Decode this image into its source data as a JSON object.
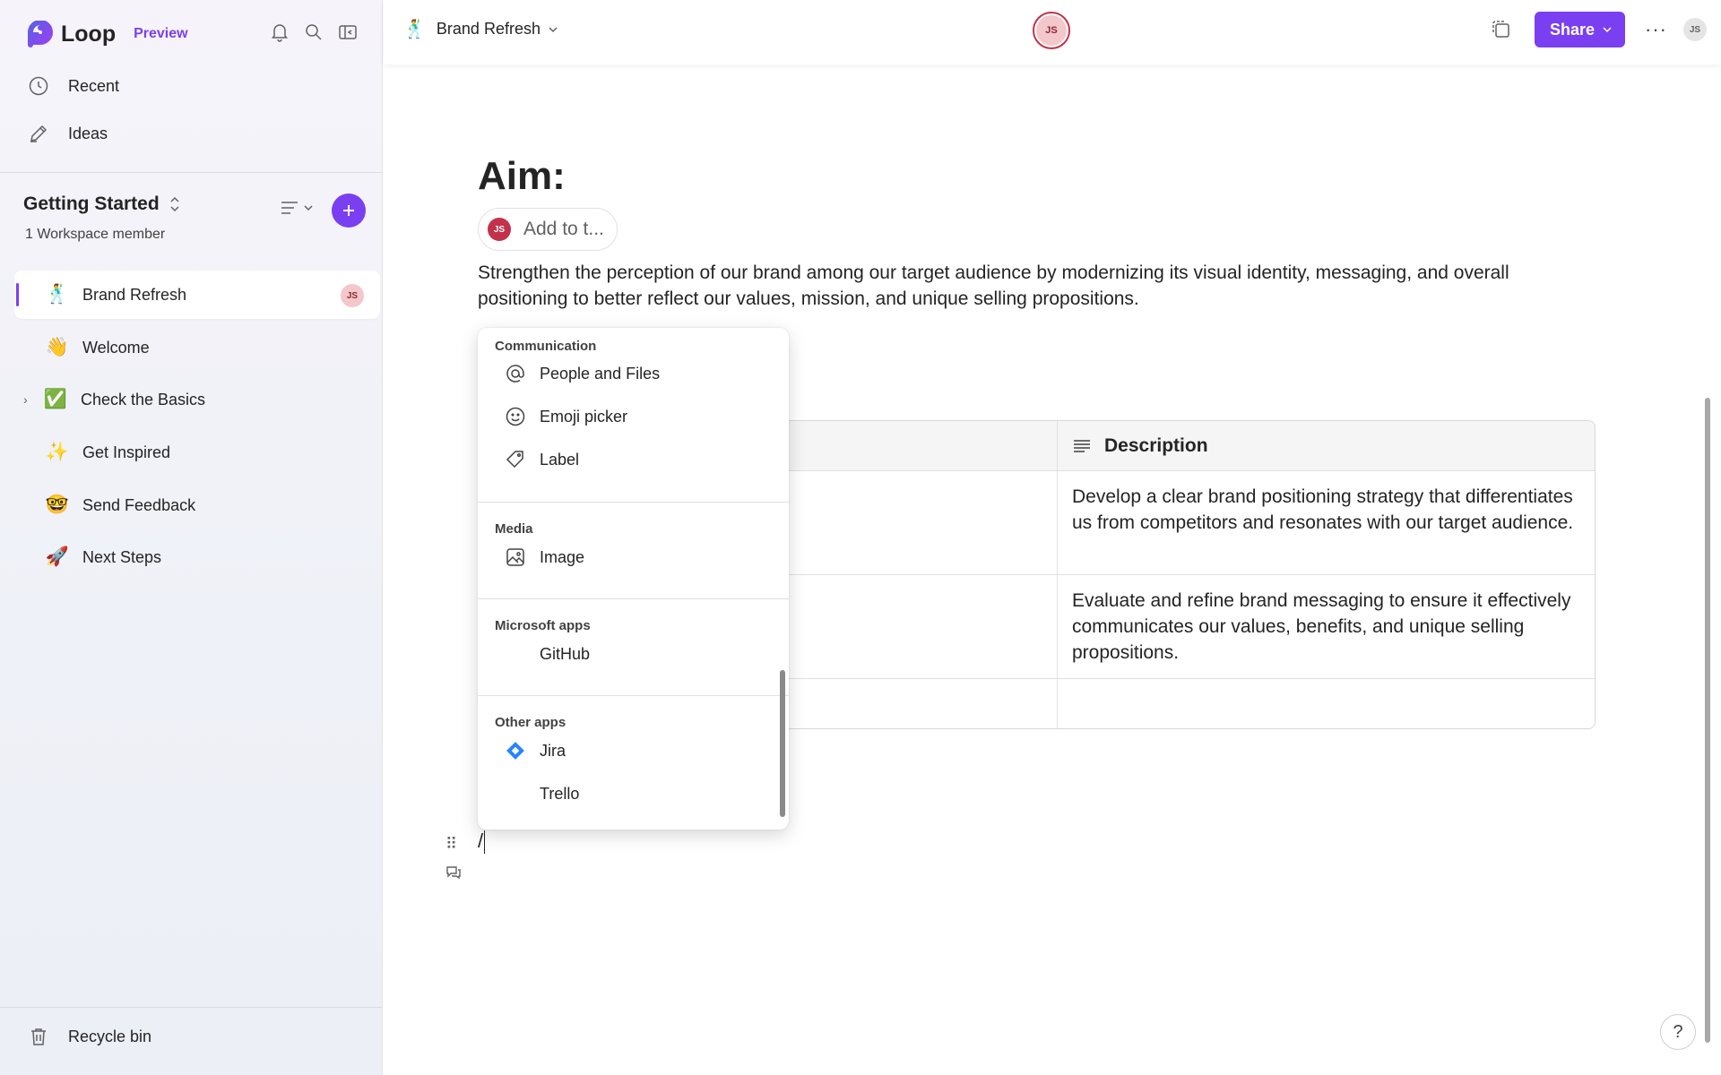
{
  "app": {
    "name": "Loop",
    "badge": "Preview"
  },
  "sidebar": {
    "nav": [
      {
        "label": "Recent",
        "icon": "clock-icon"
      },
      {
        "label": "Ideas",
        "icon": "pen-icon"
      }
    ],
    "workspace": {
      "title": "Getting Started",
      "members": "1 Workspace member"
    },
    "pages": [
      {
        "label": "Brand Refresh",
        "emoji": "🕺",
        "active": true,
        "avatar": "JS"
      },
      {
        "label": "Welcome",
        "emoji": "👋"
      },
      {
        "label": "Check the Basics",
        "emoji": "✅",
        "expandable": true
      },
      {
        "label": "Get Inspired",
        "emoji": "✨"
      },
      {
        "label": "Send Feedback",
        "emoji": "🤓"
      },
      {
        "label": "Next Steps",
        "emoji": "🚀"
      }
    ],
    "recycle_bin": "Recycle bin"
  },
  "header": {
    "doc_emoji": "🕺",
    "doc_title": "Brand Refresh",
    "presence_initials": "JS",
    "share_label": "Share",
    "more_label": "···",
    "user_initials": "JS"
  },
  "document": {
    "heading": "Aim:",
    "assign_initials": "JS",
    "assign_placeholder": "Add to t...",
    "paragraph": "Strengthen the perception of our brand among our target audience by modernizing its visual identity, messaging, and overall positioning to better reflect our values, mission, and unique selling propositions.",
    "table": {
      "column_header": "Description",
      "rows": [
        "Develop a clear brand positioning strategy that differentiates us from competitors and resonates with our target audience.",
        "Evaluate and refine brand messaging to ensure it effectively communicates our values, benefits, and unique selling propositions.",
        ""
      ]
    },
    "slash_text": "/"
  },
  "menu": {
    "sections": [
      {
        "title": "Communication",
        "items": [
          {
            "label": "People and Files",
            "icon": "at-icon"
          },
          {
            "label": "Emoji picker",
            "icon": "smiley-icon"
          },
          {
            "label": "Label",
            "icon": "tag-icon"
          }
        ]
      },
      {
        "title": "Media",
        "items": [
          {
            "label": "Image",
            "icon": "image-icon"
          }
        ]
      },
      {
        "title": "Microsoft apps",
        "items": [
          {
            "label": "GitHub",
            "icon": ""
          }
        ]
      },
      {
        "title": "Other apps",
        "items": [
          {
            "label": "Jira",
            "icon": "jira-icon"
          },
          {
            "label": "Trello",
            "icon": ""
          }
        ]
      }
    ]
  },
  "help_label": "?",
  "colors": {
    "accent": "#7b3ff2",
    "avatar_red": "#c4314b",
    "jira_blue": "#2684ff"
  }
}
